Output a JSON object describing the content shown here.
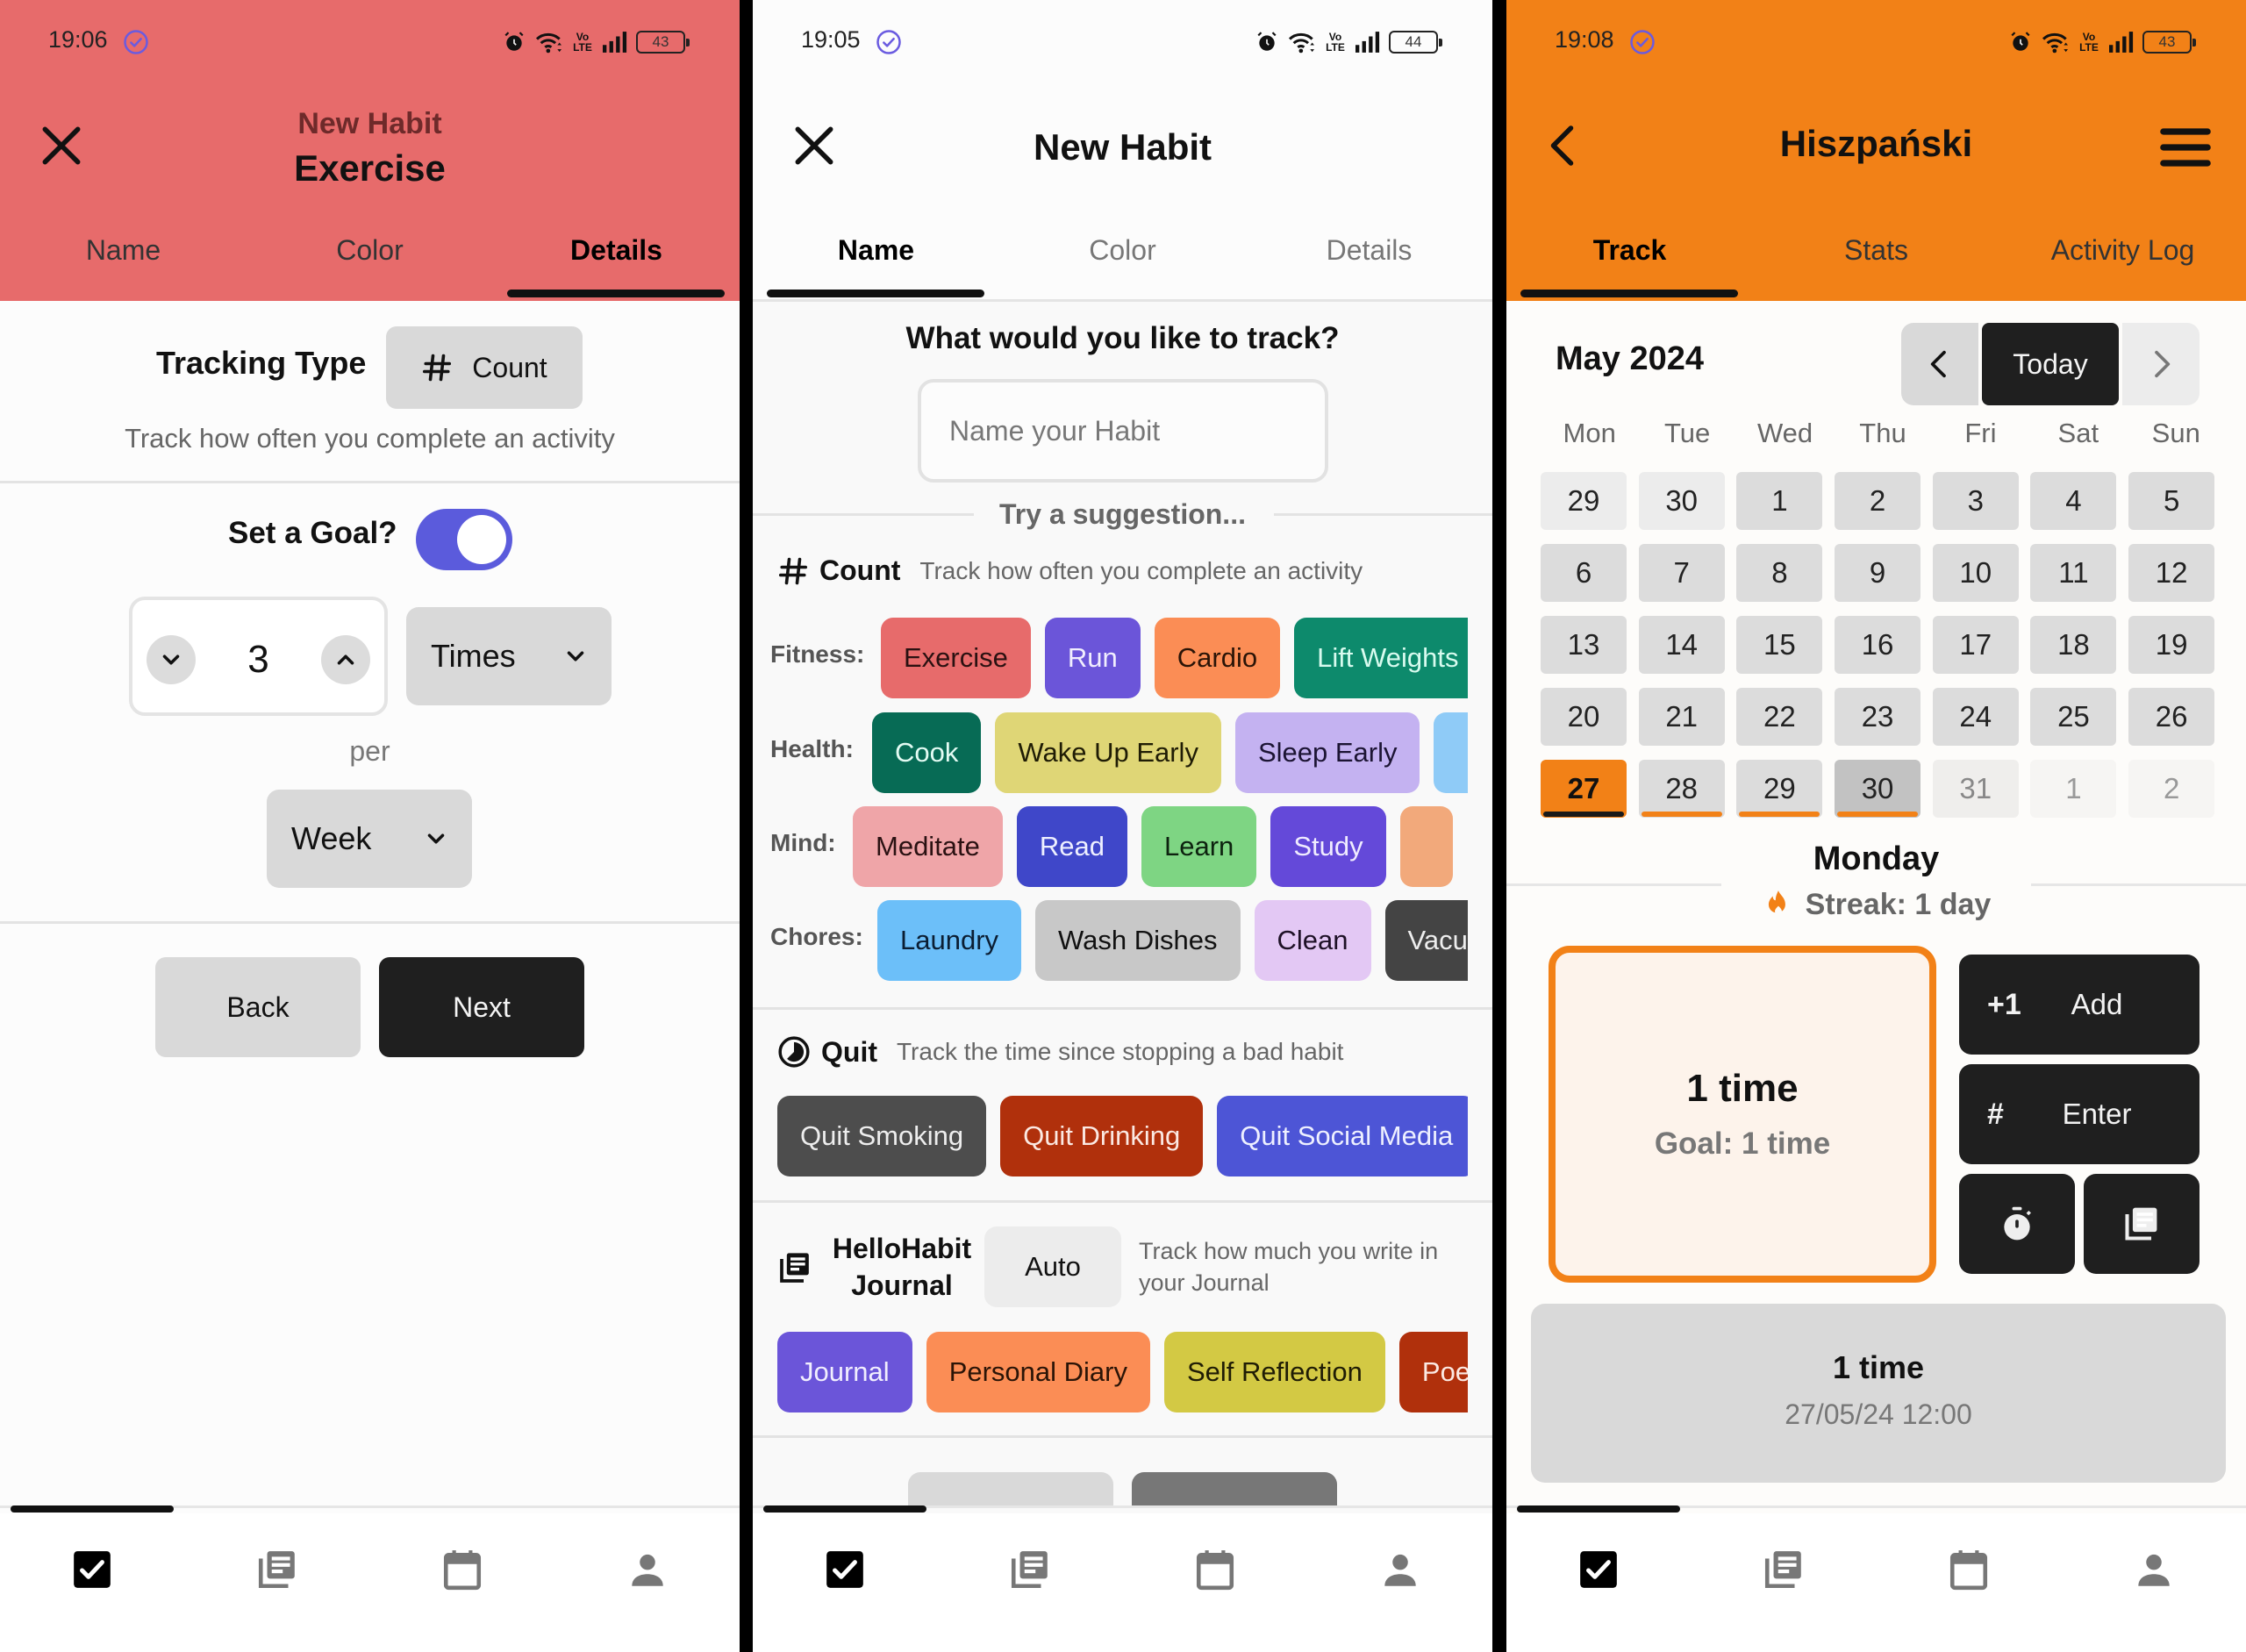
{
  "screens": [
    {
      "status": {
        "time": "19:06",
        "battery": "43"
      },
      "header": {
        "subtitle": "New Habit",
        "title": "Exercise",
        "color": "#e76b6b"
      },
      "tabs": [
        {
          "label": "Name"
        },
        {
          "label": "Color"
        },
        {
          "label": "Details"
        }
      ],
      "active_tab": "Details",
      "tracking_type": {
        "label": "Tracking Type",
        "value": "Count",
        "icon": "hash-icon",
        "description": "Track how often you complete an activity"
      },
      "goal": {
        "label": "Set a Goal?",
        "enabled": true,
        "amount": "3",
        "unit": "Times",
        "per_label": "per",
        "period": "Week"
      },
      "buttons": {
        "back": "Back",
        "next": "Next"
      }
    },
    {
      "status": {
        "time": "19:05",
        "battery": "44"
      },
      "header": {
        "title": "New Habit"
      },
      "tabs": [
        {
          "label": "Name"
        },
        {
          "label": "Color"
        },
        {
          "label": "Details"
        }
      ],
      "active_tab": "Name",
      "question": "What would you like to track?",
      "name_input": {
        "value": "",
        "placeholder": "Name your Habit"
      },
      "suggestion_label": "Try a suggestion...",
      "count_section": {
        "title": "Count",
        "description": "Track how often you complete an activity",
        "rows": [
          {
            "label": "Fitness:",
            "chips": [
              {
                "label": "Exercise",
                "bg": "#e76b6b",
                "fg": "#2a1111"
              },
              {
                "label": "Run",
                "bg": "#6b55d9",
                "fg": "#f1eefe"
              },
              {
                "label": "Cardio",
                "bg": "#fb8d55",
                "fg": "#2a1407"
              },
              {
                "label": "Lift Weights",
                "bg": "#0d8a6c",
                "fg": "#d8fbef"
              }
            ]
          },
          {
            "label": "Health:",
            "chips": [
              {
                "label": "Cook",
                "bg": "#076b55",
                "fg": "#e3fbf3"
              },
              {
                "label": "Wake Up Early",
                "bg": "#dfd676",
                "fg": "#1f1c05"
              },
              {
                "label": "Sleep Early",
                "bg": "#c4b2f1",
                "fg": "#1c1433"
              },
              {
                "label": "",
                "bg": "#8fcbf7",
                "fg": "#0d2233"
              }
            ]
          },
          {
            "label": "Mind:",
            "chips": [
              {
                "label": "Meditate",
                "bg": "#efa5a8",
                "fg": "#2a1112"
              },
              {
                "label": "Read",
                "bg": "#3f47c9",
                "fg": "#eef0ff"
              },
              {
                "label": "Learn",
                "bg": "#7ed583",
                "fg": "#0d220f"
              },
              {
                "label": "Study",
                "bg": "#6449d9",
                "fg": "#f0ecff"
              },
              {
                "label": "",
                "bg": "#f2a97b",
                "fg": "#2a1407"
              }
            ]
          },
          {
            "label": "Chores:",
            "chips": [
              {
                "label": "Laundry",
                "bg": "#6cbff9",
                "fg": "#0b1e33"
              },
              {
                "label": "Wash Dishes",
                "bg": "#c8c8c8",
                "fg": "#111111"
              },
              {
                "label": "Clean",
                "bg": "#e3c8f4",
                "fg": "#1e1126"
              },
              {
                "label": "Vacuum",
                "bg": "#444444",
                "fg": "#eeeeee"
              }
            ]
          }
        ]
      },
      "quit_section": {
        "title": "Quit",
        "description": "Track the time since stopping a bad habit",
        "chips": [
          {
            "label": "Quit Smoking",
            "bg": "#4d4d4d",
            "fg": "#eeeeee"
          },
          {
            "label": "Quit Drinking",
            "bg": "#b0300c",
            "fg": "#fbe9e3"
          },
          {
            "label": "Quit Social Media",
            "bg": "#4d55d6",
            "fg": "#eef0ff"
          }
        ]
      },
      "journal_section": {
        "title": "HelloHabit Journal",
        "badge": "Auto",
        "description": "Track how much you write in your Journal",
        "chips": [
          {
            "label": "Journal",
            "bg": "#6b55d9",
            "fg": "#f1eefe"
          },
          {
            "label": "Personal Diary",
            "bg": "#fb8d55",
            "fg": "#2a1407"
          },
          {
            "label": "Self Reflection",
            "bg": "#d3c944",
            "fg": "#1f1c05"
          },
          {
            "label": "Poetry",
            "bg": "#b0300c",
            "fg": "#fbe9e3"
          }
        ]
      }
    },
    {
      "status": {
        "time": "19:08",
        "battery": "43"
      },
      "header": {
        "title": "Hiszpański",
        "color": "#f28117"
      },
      "tabs": [
        {
          "label": "Track"
        },
        {
          "label": "Stats"
        },
        {
          "label": "Activity Log"
        }
      ],
      "active_tab": "Track",
      "calendar": {
        "month": "May 2024",
        "today_label": "Today",
        "weekdays": [
          "Mon",
          "Tue",
          "Wed",
          "Thu",
          "Fri",
          "Sat",
          "Sun"
        ],
        "days": [
          {
            "d": "29",
            "k": "prev"
          },
          {
            "d": "30",
            "k": "prev"
          },
          {
            "d": "1",
            "k": "in"
          },
          {
            "d": "2",
            "k": "in"
          },
          {
            "d": "3",
            "k": "in"
          },
          {
            "d": "4",
            "k": "in"
          },
          {
            "d": "5",
            "k": "in"
          },
          {
            "d": "6",
            "k": "in"
          },
          {
            "d": "7",
            "k": "in"
          },
          {
            "d": "8",
            "k": "in"
          },
          {
            "d": "9",
            "k": "in"
          },
          {
            "d": "10",
            "k": "in"
          },
          {
            "d": "11",
            "k": "in"
          },
          {
            "d": "12",
            "k": "in"
          },
          {
            "d": "13",
            "k": "in"
          },
          {
            "d": "14",
            "k": "in"
          },
          {
            "d": "15",
            "k": "in"
          },
          {
            "d": "16",
            "k": "in"
          },
          {
            "d": "17",
            "k": "in"
          },
          {
            "d": "18",
            "k": "in"
          },
          {
            "d": "19",
            "k": "in"
          },
          {
            "d": "20",
            "k": "in"
          },
          {
            "d": "21",
            "k": "in"
          },
          {
            "d": "22",
            "k": "in"
          },
          {
            "d": "23",
            "k": "in"
          },
          {
            "d": "24",
            "k": "in"
          },
          {
            "d": "25",
            "k": "in"
          },
          {
            "d": "26",
            "k": "in"
          },
          {
            "d": "27",
            "k": "sel",
            "bar": true
          },
          {
            "d": "28",
            "k": "in",
            "bar": true
          },
          {
            "d": "29",
            "k": "in",
            "bar": true
          },
          {
            "d": "30",
            "k": "selgray",
            "bar": true
          },
          {
            "d": "31",
            "k": "after"
          },
          {
            "d": "1",
            "k": "next"
          },
          {
            "d": "2",
            "k": "next"
          }
        ]
      },
      "selected_day": "Monday",
      "streak": "Streak: 1 day",
      "progress": {
        "value": "1 time",
        "goal": "Goal: 1 time"
      },
      "actions": {
        "add_icon": "+1",
        "add": "Add",
        "enter_icon": "#",
        "enter": "Enter"
      },
      "log_entry": {
        "value": "1 time",
        "datetime": "27/05/24 12:00"
      }
    }
  ],
  "bottom_nav": [
    {
      "name": "habits",
      "icon": "checkbox-icon",
      "active": true
    },
    {
      "name": "journal",
      "icon": "journal-icon",
      "active": false
    },
    {
      "name": "calendar",
      "icon": "calendar-icon",
      "active": false
    },
    {
      "name": "profile",
      "icon": "person-icon",
      "active": false
    }
  ]
}
